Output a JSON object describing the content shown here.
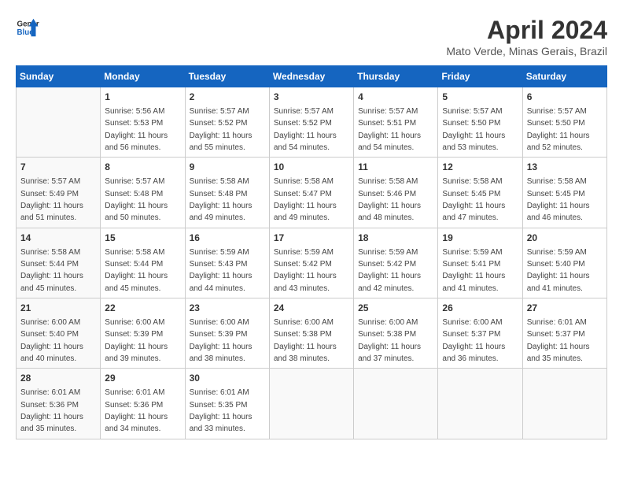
{
  "header": {
    "logo_line1": "General",
    "logo_line2": "Blue",
    "month_year": "April 2024",
    "location": "Mato Verde, Minas Gerais, Brazil"
  },
  "weekdays": [
    "Sunday",
    "Monday",
    "Tuesday",
    "Wednesday",
    "Thursday",
    "Friday",
    "Saturday"
  ],
  "weeks": [
    [
      {
        "day": "",
        "info": ""
      },
      {
        "day": "1",
        "info": "Sunrise: 5:56 AM\nSunset: 5:53 PM\nDaylight: 11 hours\nand 56 minutes."
      },
      {
        "day": "2",
        "info": "Sunrise: 5:57 AM\nSunset: 5:52 PM\nDaylight: 11 hours\nand 55 minutes."
      },
      {
        "day": "3",
        "info": "Sunrise: 5:57 AM\nSunset: 5:52 PM\nDaylight: 11 hours\nand 54 minutes."
      },
      {
        "day": "4",
        "info": "Sunrise: 5:57 AM\nSunset: 5:51 PM\nDaylight: 11 hours\nand 54 minutes."
      },
      {
        "day": "5",
        "info": "Sunrise: 5:57 AM\nSunset: 5:50 PM\nDaylight: 11 hours\nand 53 minutes."
      },
      {
        "day": "6",
        "info": "Sunrise: 5:57 AM\nSunset: 5:50 PM\nDaylight: 11 hours\nand 52 minutes."
      }
    ],
    [
      {
        "day": "7",
        "info": "Sunrise: 5:57 AM\nSunset: 5:49 PM\nDaylight: 11 hours\nand 51 minutes."
      },
      {
        "day": "8",
        "info": "Sunrise: 5:57 AM\nSunset: 5:48 PM\nDaylight: 11 hours\nand 50 minutes."
      },
      {
        "day": "9",
        "info": "Sunrise: 5:58 AM\nSunset: 5:48 PM\nDaylight: 11 hours\nand 49 minutes."
      },
      {
        "day": "10",
        "info": "Sunrise: 5:58 AM\nSunset: 5:47 PM\nDaylight: 11 hours\nand 49 minutes."
      },
      {
        "day": "11",
        "info": "Sunrise: 5:58 AM\nSunset: 5:46 PM\nDaylight: 11 hours\nand 48 minutes."
      },
      {
        "day": "12",
        "info": "Sunrise: 5:58 AM\nSunset: 5:45 PM\nDaylight: 11 hours\nand 47 minutes."
      },
      {
        "day": "13",
        "info": "Sunrise: 5:58 AM\nSunset: 5:45 PM\nDaylight: 11 hours\nand 46 minutes."
      }
    ],
    [
      {
        "day": "14",
        "info": "Sunrise: 5:58 AM\nSunset: 5:44 PM\nDaylight: 11 hours\nand 45 minutes."
      },
      {
        "day": "15",
        "info": "Sunrise: 5:58 AM\nSunset: 5:44 PM\nDaylight: 11 hours\nand 45 minutes."
      },
      {
        "day": "16",
        "info": "Sunrise: 5:59 AM\nSunset: 5:43 PM\nDaylight: 11 hours\nand 44 minutes."
      },
      {
        "day": "17",
        "info": "Sunrise: 5:59 AM\nSunset: 5:42 PM\nDaylight: 11 hours\nand 43 minutes."
      },
      {
        "day": "18",
        "info": "Sunrise: 5:59 AM\nSunset: 5:42 PM\nDaylight: 11 hours\nand 42 minutes."
      },
      {
        "day": "19",
        "info": "Sunrise: 5:59 AM\nSunset: 5:41 PM\nDaylight: 11 hours\nand 41 minutes."
      },
      {
        "day": "20",
        "info": "Sunrise: 5:59 AM\nSunset: 5:40 PM\nDaylight: 11 hours\nand 41 minutes."
      }
    ],
    [
      {
        "day": "21",
        "info": "Sunrise: 6:00 AM\nSunset: 5:40 PM\nDaylight: 11 hours\nand 40 minutes."
      },
      {
        "day": "22",
        "info": "Sunrise: 6:00 AM\nSunset: 5:39 PM\nDaylight: 11 hours\nand 39 minutes."
      },
      {
        "day": "23",
        "info": "Sunrise: 6:00 AM\nSunset: 5:39 PM\nDaylight: 11 hours\nand 38 minutes."
      },
      {
        "day": "24",
        "info": "Sunrise: 6:00 AM\nSunset: 5:38 PM\nDaylight: 11 hours\nand 38 minutes."
      },
      {
        "day": "25",
        "info": "Sunrise: 6:00 AM\nSunset: 5:38 PM\nDaylight: 11 hours\nand 37 minutes."
      },
      {
        "day": "26",
        "info": "Sunrise: 6:00 AM\nSunset: 5:37 PM\nDaylight: 11 hours\nand 36 minutes."
      },
      {
        "day": "27",
        "info": "Sunrise: 6:01 AM\nSunset: 5:37 PM\nDaylight: 11 hours\nand 35 minutes."
      }
    ],
    [
      {
        "day": "28",
        "info": "Sunrise: 6:01 AM\nSunset: 5:36 PM\nDaylight: 11 hours\nand 35 minutes."
      },
      {
        "day": "29",
        "info": "Sunrise: 6:01 AM\nSunset: 5:36 PM\nDaylight: 11 hours\nand 34 minutes."
      },
      {
        "day": "30",
        "info": "Sunrise: 6:01 AM\nSunset: 5:35 PM\nDaylight: 11 hours\nand 33 minutes."
      },
      {
        "day": "",
        "info": ""
      },
      {
        "day": "",
        "info": ""
      },
      {
        "day": "",
        "info": ""
      },
      {
        "day": "",
        "info": ""
      }
    ]
  ]
}
